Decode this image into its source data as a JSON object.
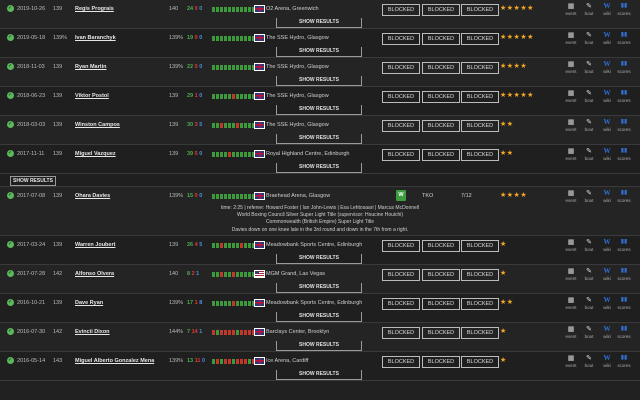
{
  "blocked_label": "BLOCKED",
  "show_results_label": "SHOW RESULTS",
  "icons": {
    "event": "event",
    "bout": "bout",
    "wiki": "wiki",
    "scores": "scores"
  },
  "colors": {
    "win": "#4caf50",
    "loss": "#e53935",
    "draw": "#4a90e2",
    "star": "#f5a623",
    "check": "#5cb85c"
  },
  "rows": [
    {
      "date": "2019-10-26",
      "num": "139",
      "name": "Regis Prograis",
      "pct": "140",
      "rec": {
        "w": "24",
        "l": "0",
        "d": "0"
      },
      "bars": "wwwwwwwwwwww",
      "flag": "uk",
      "venue": "O2 Arena, Greenwich",
      "blocked": 3,
      "stars": "★★★★★"
    },
    {
      "date": "2019-05-18",
      "num": "139%",
      "name": "Ivan Baranchyk",
      "pct": "139%",
      "rec": {
        "w": "19",
        "l": "0",
        "d": "0"
      },
      "bars": "wwwwwwwwwwww",
      "flag": "uk",
      "venue": "The SSE Hydro, Glasgow",
      "blocked": 3,
      "stars": "★★★★★"
    },
    {
      "date": "2018-11-03",
      "num": "139",
      "name": "Ryan Martin",
      "pct": "139%",
      "rec": {
        "w": "22",
        "l": "0",
        "d": "0"
      },
      "bars": "wwwwwwwwwwww",
      "flag": "uk",
      "venue": "The SSE Hydro, Glasgow",
      "blocked": 3,
      "stars": "★★★★"
    },
    {
      "date": "2018-06-23",
      "num": "139",
      "name": "Viktor Postol",
      "pct": "139",
      "rec": {
        "w": "29",
        "l": "1",
        "d": "0"
      },
      "bars": "wwwwwlwwwwww",
      "flag": "uk",
      "venue": "The SSE Hydro, Glasgow",
      "blocked": 3,
      "stars": "★★★★★"
    },
    {
      "date": "2018-03-03",
      "num": "139",
      "name": "Winston Campos",
      "pct": "139",
      "rec": {
        "w": "30",
        "l": "3",
        "d": "5"
      },
      "bars": "wwlwwwlwwwww",
      "flag": "uk",
      "venue": "The SSE Hydro, Glasgow",
      "blocked": 3,
      "stars": "★★"
    },
    {
      "date": "2017-11-11",
      "num": "139",
      "name": "Miguel Vazquez",
      "pct": "139",
      "rec": {
        "w": "39",
        "l": "5",
        "d": "0"
      },
      "bars": "wwwwlwwwwwww",
      "flag": "uk",
      "venue": "Royal Highland Centre, Edinburgh",
      "blocked": 3,
      "stars": "★★"
    }
  ],
  "plain_show": "SHOW RESULTS",
  "featured": {
    "date": "2017-07-08",
    "num": "139",
    "name": "Ohara Davies",
    "pct": "139%",
    "rec": {
      "w": "15",
      "l": "0",
      "d": "0"
    },
    "bars": "wwwwwwwwwwww",
    "flag": "uk",
    "venue": "Braehead Arena, Glasgow",
    "win_badge": "W",
    "method": "TKO",
    "round": "7/12",
    "stars": "★★★★",
    "details": [
      "time: 2:25 | referee: Howard Foster | Ian John-Lewis | Esa Lehtosaari | Marcus McDonnell",
      "World Boxing Council Silver Super Light Title (supervisor: Houcine Houichi)",
      "Commonwealth (British Empire) Super Light Title",
      "Davies down on one knee late in the 3rd round and down in the 7th from a right."
    ]
  },
  "rows2": [
    {
      "date": "2017-03-24",
      "num": "139",
      "name": "Warren Joubert",
      "pct": "139",
      "rec": {
        "w": "26",
        "l": "4",
        "d": "5"
      },
      "bars": "wwlwwwwlwwww",
      "flag": "uk",
      "venue": "Meadowbank Sports Centre, Edinburgh",
      "blocked": 3,
      "stars": "★"
    },
    {
      "date": "2017-07-28",
      "num": "142",
      "name": "Alfonso Olvera",
      "pct": "140",
      "rec": {
        "w": "8",
        "l": "2",
        "d": "1"
      },
      "bars": "wwlwwlwwwwww",
      "flag": "us",
      "venue": "MGM Grand, Las Vegas",
      "blocked": 3,
      "stars": "★"
    },
    {
      "date": "2016-10-21",
      "num": "139",
      "name": "Dave Ryan",
      "pct": "139%",
      "rec": {
        "w": "17",
        "l": "1",
        "d": "8"
      },
      "bars": "wwwwwlwwwwww",
      "flag": "uk",
      "venue": "Meadowbank Sports Centre, Edinburgh",
      "blocked": 3,
      "stars": "★★"
    },
    {
      "date": "2016-07-30",
      "num": "142",
      "name": "Evincii Dixon",
      "pct": "144%",
      "rec": {
        "w": "7",
        "l": "14",
        "d": "1"
      },
      "bars": "lwllllwlllll",
      "flag": "uk",
      "venue": "Barclays Center, Brooklyn",
      "blocked": 3,
      "stars": "★"
    },
    {
      "date": "2016-05-14",
      "num": "143",
      "name": "Miguel Alberto Gonzalez Mena",
      "pct": "139%",
      "rec": {
        "w": "13",
        "l": "11",
        "d": "0"
      },
      "bars": "wlwllwlllwll",
      "flag": "uk",
      "venue": "Ice Arena, Cardiff",
      "blocked": 3,
      "stars": "★"
    }
  ]
}
